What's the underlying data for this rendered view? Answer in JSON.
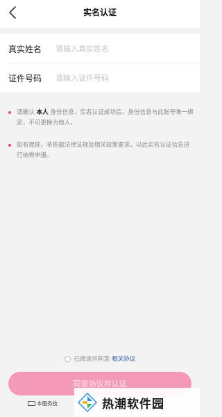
{
  "header": {
    "title": "实名认证"
  },
  "form": {
    "name_label": "真实姓名",
    "name_placeholder": "请输入真实姓名",
    "id_label": "证件号码",
    "id_placeholder": "请输入证件号码"
  },
  "notes": {
    "n1_prefix": "请确认 ",
    "n1_strong": "本人",
    "n1_rest": " 身份信息，实名认证成功后，身份信息与此账号唯一绑定，不可更换为他人。",
    "n2": "如有提现，将依据法律法规及相关政策要求，以此实名认证信息进行纳税申报。"
  },
  "agreement": {
    "text": "已阅读并同意",
    "link": "相关协议"
  },
  "submit": {
    "label": "同意协议并认证"
  },
  "footer": {
    "text": "本服务技"
  },
  "watermark": {
    "text": "热潮软件园"
  },
  "colors": {
    "accent": "#e84a7e",
    "button": "#f29ab7",
    "link": "#3a5aa6"
  }
}
